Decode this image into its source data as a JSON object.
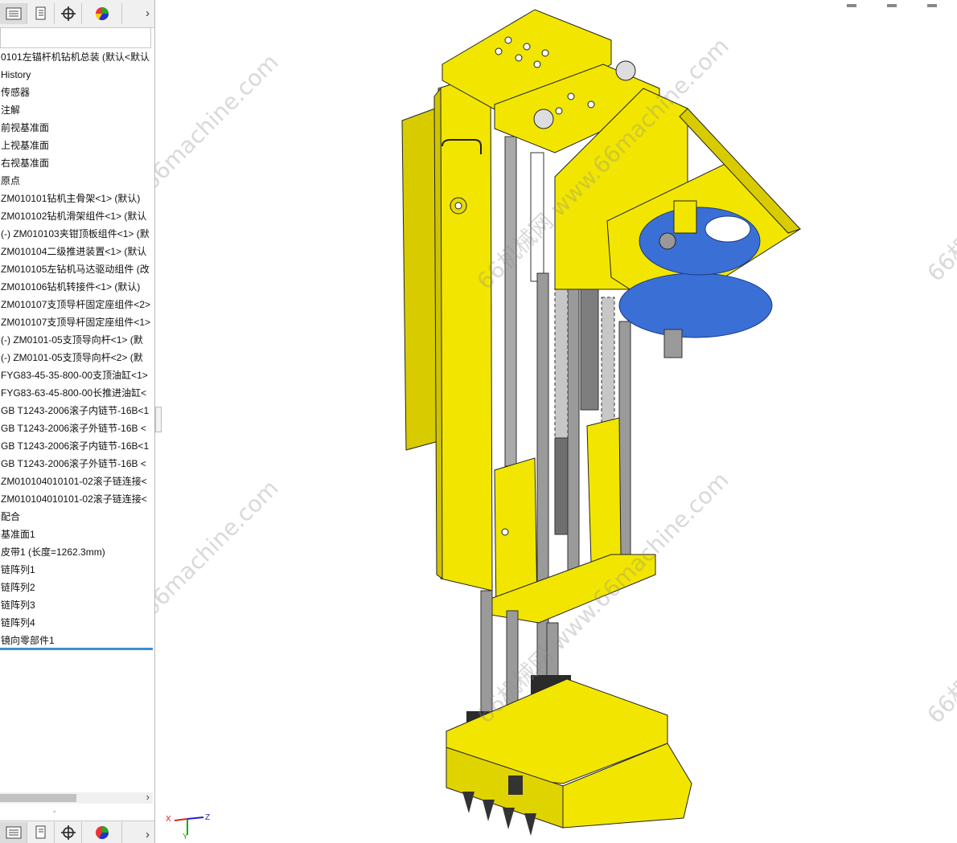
{
  "toolbar": {
    "icons": [
      "feature-manager-icon",
      "property-manager-icon",
      "configuration-manager-icon",
      "display-manager-icon"
    ],
    "more_glyph": "›"
  },
  "tree": {
    "items": [
      "0101左锚杆机钻机总装  (默认<默认",
      "History",
      "传感器",
      "注解",
      "前视基准面",
      "上视基准面",
      "右视基准面",
      "原点",
      "ZM010101钻机主骨架<1> (默认)",
      "ZM010102钻机滑架组件<1> (默认",
      "(-) ZM010103夹钳顶板组件<1> (默",
      "ZM010104二级推进装置<1> (默认",
      "ZM010105左钻机马达驱动组件 (改",
      "ZM010106钻机转接件<1> (默认)",
      "ZM010107支顶导杆固定座组件<2>",
      "ZM010107支顶导杆固定座组件<1>",
      "(-) ZM0101-05支顶导向杆<1> (默",
      "(-) ZM0101-05支顶导向杆<2> (默",
      "FYG83-45-35-800-00支顶油缸<1>",
      "FYG83-63-45-800-00长推进油缸<",
      "GB T1243-2006滚子内链节-16B<1",
      "GB T1243-2006滚子外链节-16B <",
      "GB T1243-2006滚子内链节-16B<1",
      "GB T1243-2006滚子外链节-16B <",
      "ZM010104010101-02滚子链连接<",
      "ZM010104010101-02滚子链连接<",
      "配合",
      "基准面1",
      "皮带1 (长度=1262.3mm)",
      "链阵列1",
      "链阵列2",
      "链阵列3",
      "链阵列4",
      "镜向零部件1"
    ]
  },
  "scroll": {
    "right_glyph": "›",
    "middle_glyph": "◦"
  },
  "triad": {
    "x": "X",
    "y": "Y",
    "z": "Z"
  },
  "watermark": {
    "text": "66机械网 www.66machine.com"
  },
  "colors": {
    "frame_yellow": "#f2e600",
    "frame_shade": "#cfc200",
    "motor_blue": "#3a6fd6",
    "steel": "#9a9a9a",
    "dark": "#2b2b2b",
    "accent_selection": "#3b8ed6"
  }
}
